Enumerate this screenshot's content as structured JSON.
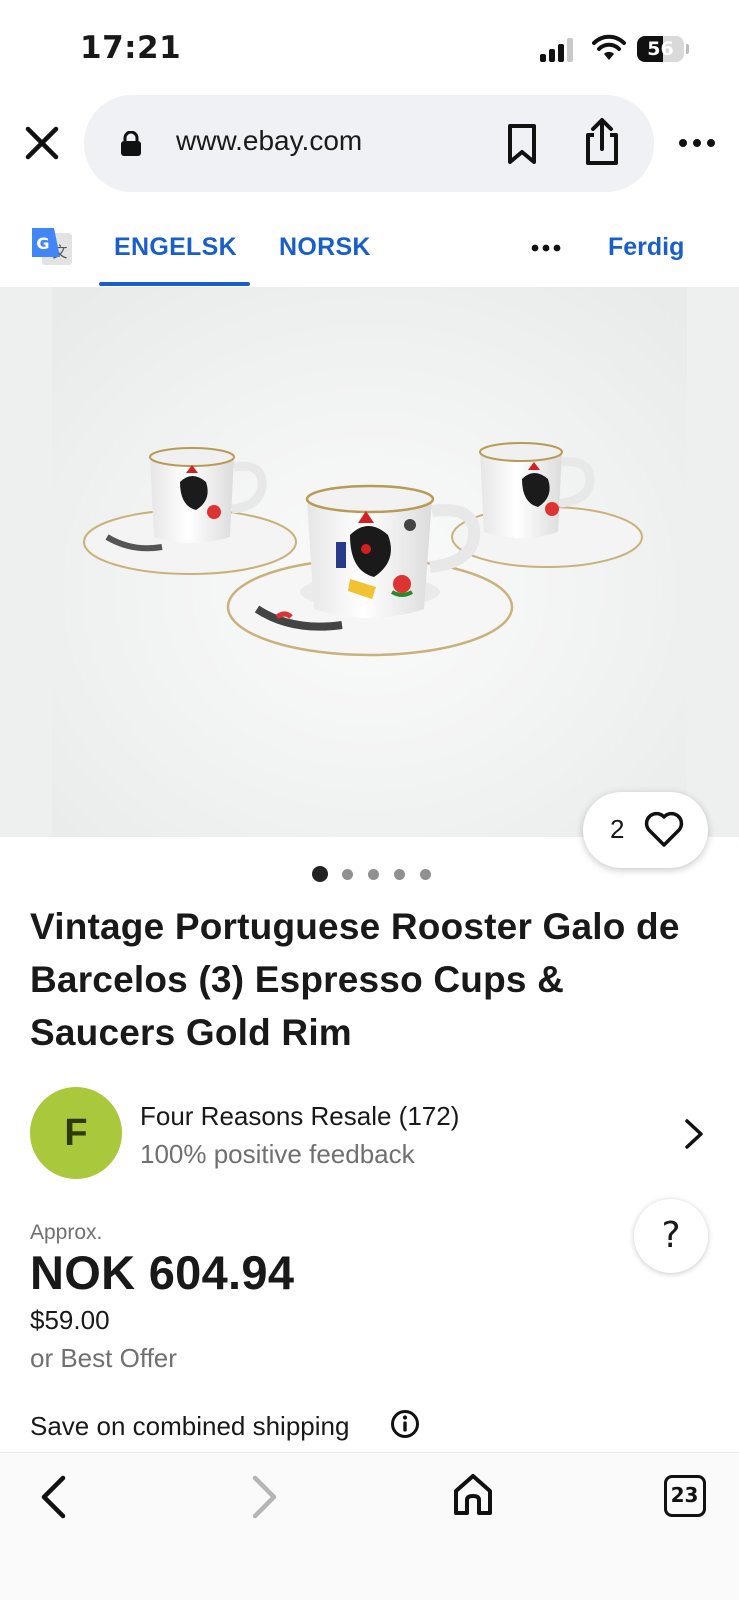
{
  "status_bar": {
    "time": "17:21",
    "battery": "56",
    "battery_level": 0.56
  },
  "browser": {
    "url": "www.ebay.com",
    "icons": [
      "close-icon",
      "lock-icon",
      "bookmark-icon",
      "share-icon",
      "more-icon"
    ]
  },
  "translate_bar": {
    "tab_english": "ENGELSK",
    "tab_norwegian": "NORSK",
    "done_label": "Ferdig",
    "active_tab": "ENGELSK",
    "accent_color": "#1a5fc9"
  },
  "gallery": {
    "watch_count": "2",
    "image_count": 5,
    "active_image": 1
  },
  "listing": {
    "title": "Vintage Portuguese Rooster Galo de Barcelos (3) Espresso Cups & Saucers Gold Rim"
  },
  "seller": {
    "initial": "F",
    "name": "Four Reasons Resale (172)",
    "feedback": "100% positive feedback",
    "avatar_color": "#a9c83c"
  },
  "price": {
    "approx_label": "Approx.",
    "main": "NOK 604.94",
    "original": "$59.00",
    "offer": "or Best Offer"
  },
  "help": {
    "label": "?"
  },
  "shipping": {
    "label": "Save on combined shipping"
  },
  "toolbar": {
    "tab_count": "23"
  }
}
